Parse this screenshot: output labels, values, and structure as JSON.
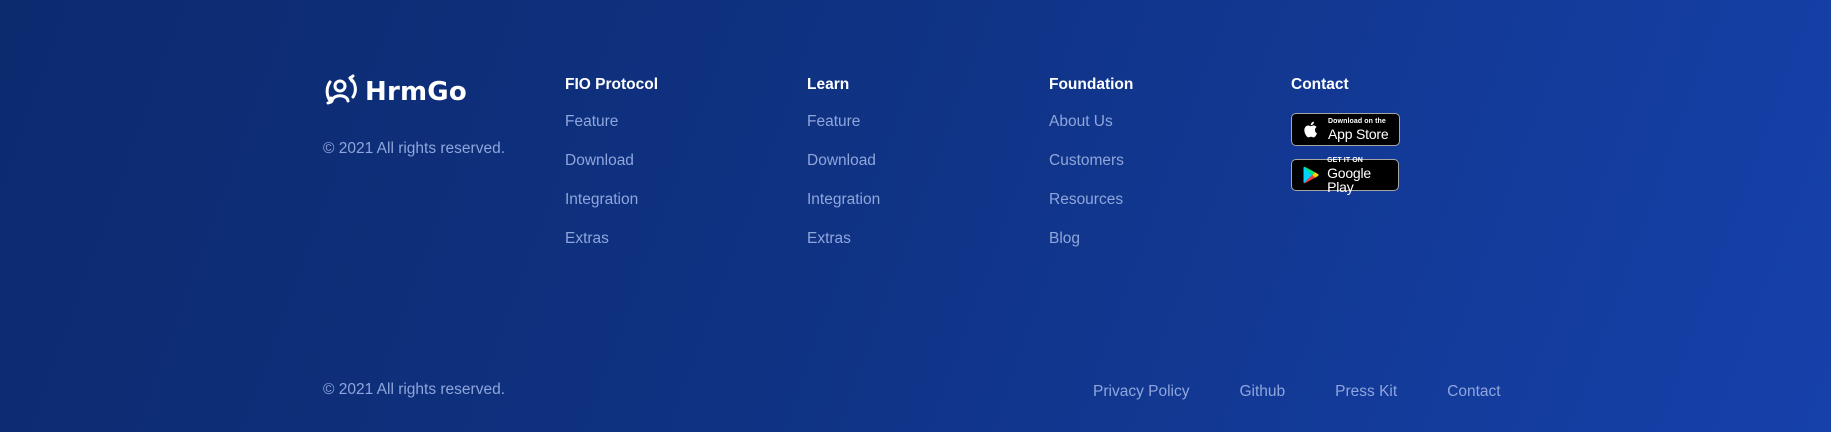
{
  "brand": {
    "name": "HrmGo",
    "logo_icon": "people-sync-icon",
    "copyright": "© 2021 All rights reserved."
  },
  "columns": [
    {
      "title": "FIO Protocol",
      "links": [
        "Feature",
        "Download",
        "Integration",
        "Extras"
      ]
    },
    {
      "title": "Learn",
      "links": [
        "Feature",
        "Download",
        "Integration",
        "Extras"
      ]
    },
    {
      "title": "Foundation",
      "links": [
        "About Us",
        "Customers",
        "Resources",
        "Blog"
      ]
    }
  ],
  "contact": {
    "title": "Contact",
    "app_store": {
      "small": "Download on the",
      "big": "App Store",
      "icon": "apple-icon"
    },
    "google_play": {
      "small": "GET IT ON",
      "big": "Google Play",
      "icon": "google-play-icon"
    }
  },
  "bottom": {
    "copyright": "© 2021 All rights reserved.",
    "links": [
      "Privacy Policy",
      "Github",
      "Press Kit",
      "Contact"
    ]
  },
  "colors": {
    "background_start": "#0c2a6e",
    "background_end": "#1641aa",
    "link": "#8fa6dc",
    "heading": "#ffffff"
  }
}
